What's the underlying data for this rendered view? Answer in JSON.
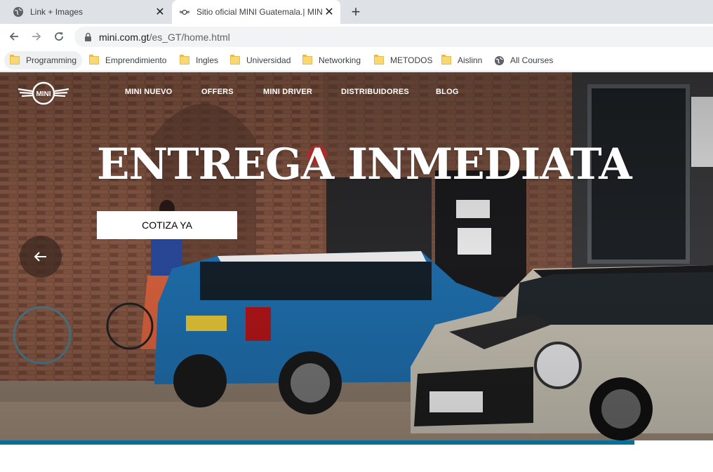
{
  "browser": {
    "tabs": [
      {
        "title": "Link + Images",
        "icon": "globe-icon",
        "active": false
      },
      {
        "title": "Sitio oficial MINI Guatemala.| MINI",
        "icon": "mini-favicon-icon",
        "active": true
      }
    ],
    "url_host": "mini.com.gt",
    "url_path": "/es_GT/home.html",
    "bookmarks": [
      {
        "label": "Programming",
        "icon": "folder-icon"
      },
      {
        "label": "Emprendimiento",
        "icon": "folder-icon"
      },
      {
        "label": "Ingles",
        "icon": "folder-icon"
      },
      {
        "label": "Universidad",
        "icon": "folder-icon"
      },
      {
        "label": "Networking",
        "icon": "folder-icon"
      },
      {
        "label": "METODOS",
        "icon": "folder-icon"
      },
      {
        "label": "Aislinn",
        "icon": "folder-icon"
      },
      {
        "label": "All Courses",
        "icon": "globe-icon"
      }
    ]
  },
  "site": {
    "logo_text": "MINI",
    "nav": [
      "MINI NUEVO",
      "OFFERS",
      "MINI DRIVER",
      "DISTRIBUIDORES",
      "BLOG"
    ],
    "headline": "ENTREGA INMEDIATA",
    "cta": "COTIZA YA",
    "carousel_progress": 0.89
  },
  "colors": {
    "accent": "#0a6f97",
    "tabstrip": "#dee1e6",
    "omnibox": "#f1f3f4"
  }
}
